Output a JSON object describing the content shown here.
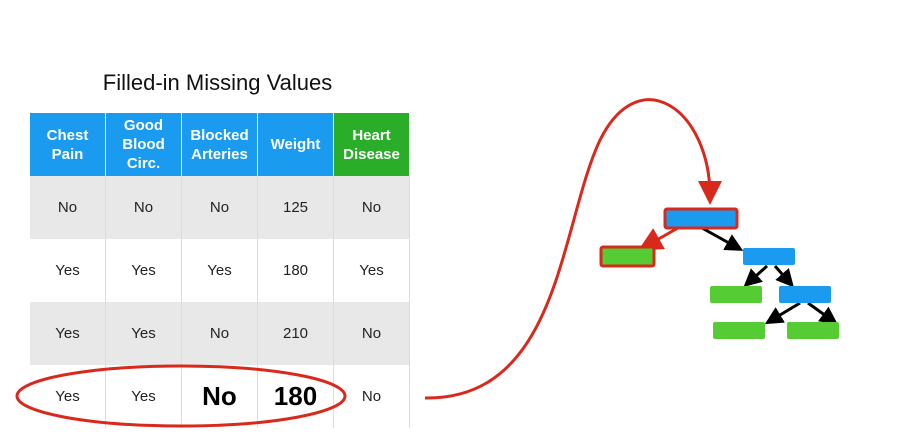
{
  "title": "Filled-in Missing Values",
  "table": {
    "headers": [
      "Chest Pain",
      "Good Blood Circ.",
      "Blocked Arteries",
      "Weight",
      "Heart Disease"
    ],
    "rows": [
      [
        "No",
        "No",
        "No",
        "125",
        "No"
      ],
      [
        "Yes",
        "Yes",
        "Yes",
        "180",
        "Yes"
      ],
      [
        "Yes",
        "Yes",
        "No",
        "210",
        "No"
      ],
      [
        "Yes",
        "Yes",
        "No",
        "180",
        "No"
      ]
    ],
    "highlighted_values": [
      "No",
      "180"
    ]
  },
  "colors": {
    "feature_header": "#1a9bf0",
    "target_header": "#2aae2a",
    "highlight": "#d9291c",
    "tree_internal_node": "#1a9bf0",
    "tree_leaf": "#55cc33"
  }
}
